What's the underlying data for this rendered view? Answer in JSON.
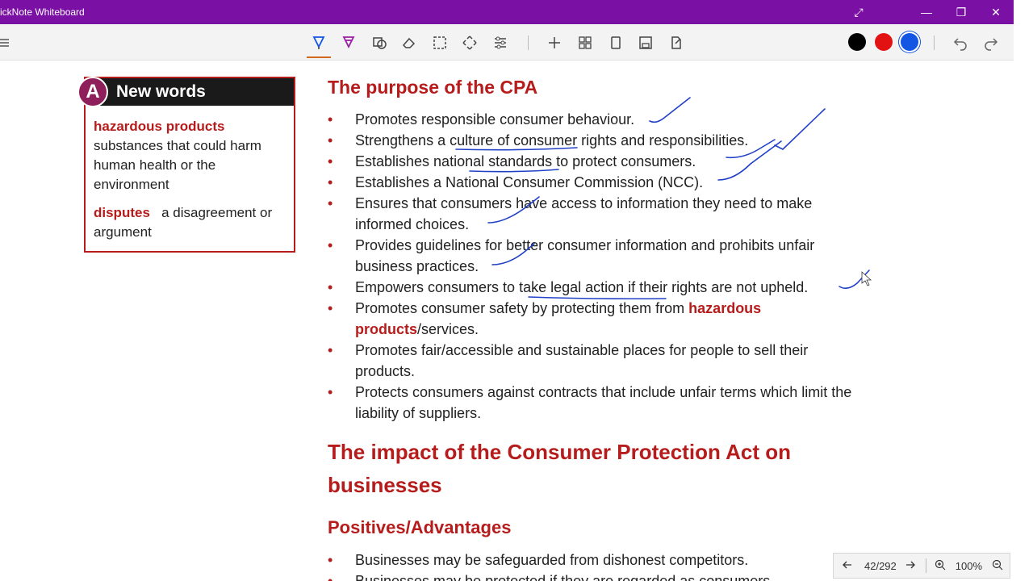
{
  "window": {
    "title": "ickNote Whiteboard",
    "controls": {
      "resize": "⤢",
      "minimize": "—",
      "restore": "❐",
      "close": "✕"
    }
  },
  "toolbar": {
    "colors": [
      "#000000",
      "#e31212",
      "#1256e3"
    ]
  },
  "sidebar_box": {
    "badge": "A",
    "heading": "New words",
    "terms": [
      {
        "term": "hazardous products",
        "definition": "substances that could harm human health or the environment"
      },
      {
        "term": "disputes",
        "definition": "a disagreement or argument"
      }
    ]
  },
  "main": {
    "heading": "The purpose of the CPA",
    "bullets": [
      "Promotes responsible consumer behaviour.",
      "Strengthens a culture of consumer rights and responsibilities.",
      "Establishes national standards to protect consumers.",
      "Establishes a National Consumer Commission (NCC).",
      "Ensures that consumers have access to information they need to make informed choices.",
      "Provides guidelines for better consumer information and prohibits unfair business practices.",
      "Empowers consumers to take legal action if their rights are not upheld.",
      "Promotes fair/accessible and sustainable places for people to sell their products.",
      "Protects consumers against contracts that include unfair terms which limit the liability of suppliers."
    ],
    "safety_bullet": {
      "before": "Promotes consumer safety by protecting them from ",
      "highlight": "hazardous products",
      "after": "/services."
    },
    "impact_heading": "The impact of the Consumer Protection Act on businesses",
    "subheading": "Positives/Advantages",
    "positive_bullets": [
      "Businesses may be safeguarded from dishonest competitors.",
      "Businesses may be protected if they are regarded as consumers."
    ]
  },
  "pager": {
    "page_indicator": "42/292",
    "zoom": "100%"
  }
}
